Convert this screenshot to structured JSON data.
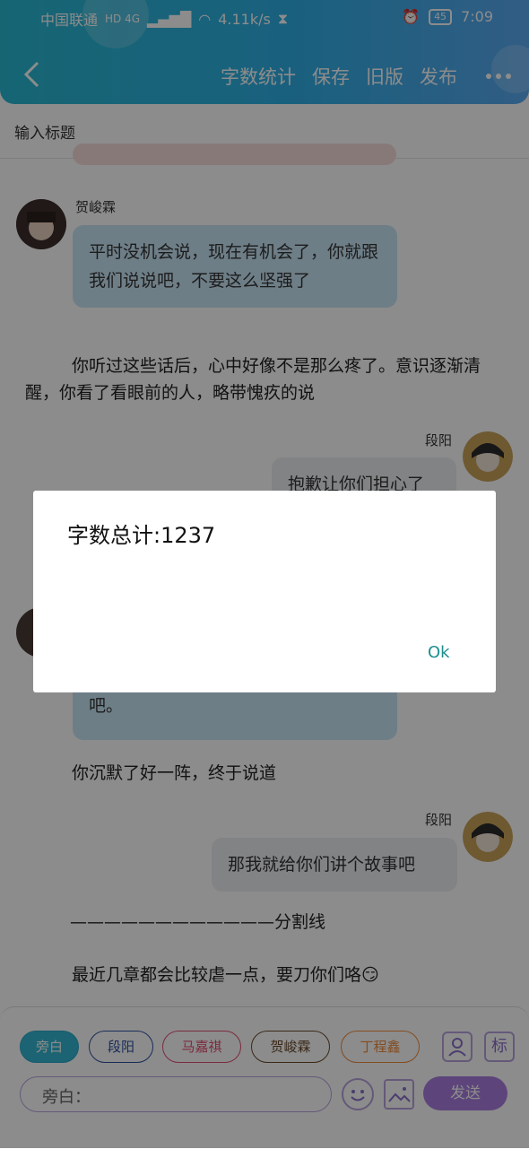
{
  "status": {
    "carrier": "中国联通",
    "network": "HD 4G",
    "speed": "4.11k/s",
    "battery": "45",
    "time": "7:09"
  },
  "header": {
    "back_icon": "chevron-left-icon",
    "menu": [
      "字数统计",
      "保存",
      "旧版",
      "发布"
    ],
    "more_icon": "more-dots-icon"
  },
  "title_placeholder": "输入标题",
  "messages": [
    {
      "type": "partial",
      "text": "…"
    },
    {
      "type": "left",
      "name": "贺峻霖",
      "text": "平时没机会说，现在有机会了，你就跟我们说说吧，不要这么坚强了"
    },
    {
      "type": "narration",
      "text": "你听过这些话后，心中好像不是那么疼了。意识逐渐清醒，你看了看眼前的人，略带愧疚的说"
    },
    {
      "type": "right",
      "name": "段阳",
      "text": "抱歉让你们担心了"
    },
    {
      "type": "left",
      "name": "",
      "text": "吧。"
    },
    {
      "type": "narration",
      "text": "你沉默了好一阵，终于说道"
    },
    {
      "type": "right",
      "name": "段阳",
      "text": "那我就给你们讲个故事吧"
    },
    {
      "type": "divider",
      "text": "————————————分割线"
    },
    {
      "type": "narration",
      "text": "最近几章都会比较虐一点，要刀你们咯😏"
    }
  ],
  "characters": [
    {
      "label": "旁白",
      "border": "#2aa8c8",
      "text": "#ffffff",
      "bg": "#33b6d1"
    },
    {
      "label": "段阳",
      "border": "#2c4fa0",
      "text": "#2c4fa0",
      "bg": "#ffffff"
    },
    {
      "label": "马嘉祺",
      "border": "#e04f72",
      "text": "#e04f72",
      "bg": "#ffffff"
    },
    {
      "label": "贺峻霖",
      "border": "#6b4a2a",
      "text": "#6b4a2a",
      "bg": "#ffffff"
    },
    {
      "label": "丁程鑫",
      "border": "#f08a3a",
      "text": "#f08a3a",
      "bg": "#ffffff"
    }
  ],
  "bottom": {
    "person_icon": "person-card-icon",
    "tag_label": "标",
    "input_label": "旁白：",
    "emoji_icon": "smiley-icon",
    "image_icon": "image-icon",
    "send_label": "发送"
  },
  "dialog": {
    "message": "字数总计:1237",
    "ok": "Ok"
  }
}
